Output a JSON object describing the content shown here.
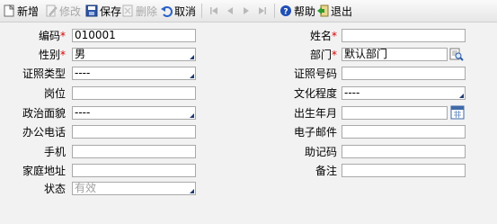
{
  "toolbar": {
    "new_label": "新增",
    "edit_label": "修改",
    "save_label": "保存",
    "delete_label": "删除",
    "cancel_label": "取消",
    "help_label": "帮助",
    "exit_label": "退出"
  },
  "form": {
    "code": {
      "label": "编码",
      "value": "010001"
    },
    "name": {
      "label": "姓名",
      "value": ""
    },
    "gender": {
      "label": "性别",
      "value": "男"
    },
    "department": {
      "label": "部门",
      "value": "默认部门"
    },
    "id_type": {
      "label": "证照类型",
      "value": "----"
    },
    "id_number": {
      "label": "证照号码",
      "value": ""
    },
    "position": {
      "label": "岗位",
      "value": ""
    },
    "education": {
      "label": "文化程度",
      "value": "----"
    },
    "political": {
      "label": "政治面貌",
      "value": "----"
    },
    "birth": {
      "label": "出生年月",
      "value": ""
    },
    "office_phone": {
      "label": "办公电话",
      "value": ""
    },
    "email": {
      "label": "电子邮件",
      "value": ""
    },
    "mobile": {
      "label": "手机",
      "value": ""
    },
    "mnemonic": {
      "label": "助记码",
      "value": ""
    },
    "address": {
      "label": "家庭地址",
      "value": ""
    },
    "remark": {
      "label": "备注",
      "value": ""
    },
    "status": {
      "label": "状态",
      "value": "有效"
    }
  },
  "required_marker": "*",
  "colors": {
    "required": "#d40000",
    "combo_arrow": "#1f3b73",
    "background": "#f2f2f2"
  }
}
